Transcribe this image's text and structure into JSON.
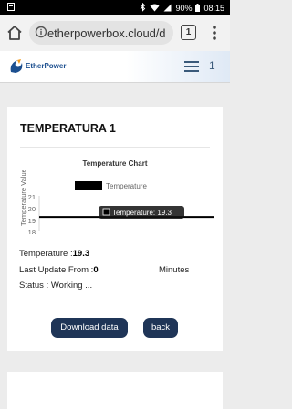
{
  "status_bar": {
    "battery": "90%",
    "time": "08:15",
    "icons": [
      "notification-icon",
      "bluetooth-icon",
      "wifi-icon",
      "signal-icon",
      "battery-icon"
    ]
  },
  "browser": {
    "url": "etherpowerbox.cloud/d",
    "tab_count": "1"
  },
  "site_header": {
    "logo_text": "EtherPower",
    "menu_label": "1"
  },
  "card": {
    "title": "TEMPERATURA 1",
    "temperature_label": "Temperature :",
    "temperature_value": "19.3",
    "last_update_label": "Last Update From :",
    "last_update_value": "0",
    "last_update_unit": "Minutes",
    "status_label": "Status :",
    "status_value": "Working ...",
    "download_button": "Download data",
    "back_button": "back"
  },
  "chart_data": {
    "type": "line",
    "title": "Temperature Chart",
    "ylabel": "Temperature Value",
    "legend": "Temperature",
    "yticks": [
      "21",
      "20",
      "19",
      "18"
    ],
    "ylim": [
      18,
      21
    ],
    "series": [
      {
        "name": "Temperature",
        "values": [
          19.3,
          19.3
        ]
      }
    ],
    "tooltip": "Temperature: 19.3"
  },
  "colors": {
    "button_bg": "#1f3557",
    "brand_blue": "#1c4f8f",
    "brand_orange": "#f29a1d"
  }
}
